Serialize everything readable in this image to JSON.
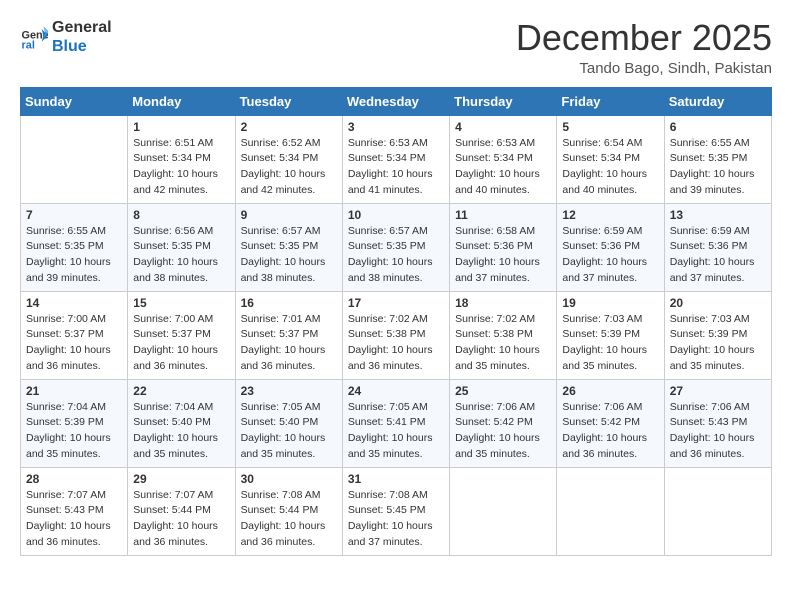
{
  "logo": {
    "line1": "General",
    "line2": "Blue"
  },
  "header": {
    "month": "December 2025",
    "location": "Tando Bago, Sindh, Pakistan"
  },
  "days_of_week": [
    "Sunday",
    "Monday",
    "Tuesday",
    "Wednesday",
    "Thursday",
    "Friday",
    "Saturday"
  ],
  "weeks": [
    [
      {
        "day": "",
        "sunrise": "",
        "sunset": "",
        "daylight": ""
      },
      {
        "day": "1",
        "sunrise": "6:51 AM",
        "sunset": "5:34 PM",
        "daylight": "10 hours and 42 minutes."
      },
      {
        "day": "2",
        "sunrise": "6:52 AM",
        "sunset": "5:34 PM",
        "daylight": "10 hours and 42 minutes."
      },
      {
        "day": "3",
        "sunrise": "6:53 AM",
        "sunset": "5:34 PM",
        "daylight": "10 hours and 41 minutes."
      },
      {
        "day": "4",
        "sunrise": "6:53 AM",
        "sunset": "5:34 PM",
        "daylight": "10 hours and 40 minutes."
      },
      {
        "day": "5",
        "sunrise": "6:54 AM",
        "sunset": "5:34 PM",
        "daylight": "10 hours and 40 minutes."
      },
      {
        "day": "6",
        "sunrise": "6:55 AM",
        "sunset": "5:35 PM",
        "daylight": "10 hours and 39 minutes."
      }
    ],
    [
      {
        "day": "7",
        "sunrise": "6:55 AM",
        "sunset": "5:35 PM",
        "daylight": "10 hours and 39 minutes."
      },
      {
        "day": "8",
        "sunrise": "6:56 AM",
        "sunset": "5:35 PM",
        "daylight": "10 hours and 38 minutes."
      },
      {
        "day": "9",
        "sunrise": "6:57 AM",
        "sunset": "5:35 PM",
        "daylight": "10 hours and 38 minutes."
      },
      {
        "day": "10",
        "sunrise": "6:57 AM",
        "sunset": "5:35 PM",
        "daylight": "10 hours and 38 minutes."
      },
      {
        "day": "11",
        "sunrise": "6:58 AM",
        "sunset": "5:36 PM",
        "daylight": "10 hours and 37 minutes."
      },
      {
        "day": "12",
        "sunrise": "6:59 AM",
        "sunset": "5:36 PM",
        "daylight": "10 hours and 37 minutes."
      },
      {
        "day": "13",
        "sunrise": "6:59 AM",
        "sunset": "5:36 PM",
        "daylight": "10 hours and 37 minutes."
      }
    ],
    [
      {
        "day": "14",
        "sunrise": "7:00 AM",
        "sunset": "5:37 PM",
        "daylight": "10 hours and 36 minutes."
      },
      {
        "day": "15",
        "sunrise": "7:00 AM",
        "sunset": "5:37 PM",
        "daylight": "10 hours and 36 minutes."
      },
      {
        "day": "16",
        "sunrise": "7:01 AM",
        "sunset": "5:37 PM",
        "daylight": "10 hours and 36 minutes."
      },
      {
        "day": "17",
        "sunrise": "7:02 AM",
        "sunset": "5:38 PM",
        "daylight": "10 hours and 36 minutes."
      },
      {
        "day": "18",
        "sunrise": "7:02 AM",
        "sunset": "5:38 PM",
        "daylight": "10 hours and 35 minutes."
      },
      {
        "day": "19",
        "sunrise": "7:03 AM",
        "sunset": "5:39 PM",
        "daylight": "10 hours and 35 minutes."
      },
      {
        "day": "20",
        "sunrise": "7:03 AM",
        "sunset": "5:39 PM",
        "daylight": "10 hours and 35 minutes."
      }
    ],
    [
      {
        "day": "21",
        "sunrise": "7:04 AM",
        "sunset": "5:39 PM",
        "daylight": "10 hours and 35 minutes."
      },
      {
        "day": "22",
        "sunrise": "7:04 AM",
        "sunset": "5:40 PM",
        "daylight": "10 hours and 35 minutes."
      },
      {
        "day": "23",
        "sunrise": "7:05 AM",
        "sunset": "5:40 PM",
        "daylight": "10 hours and 35 minutes."
      },
      {
        "day": "24",
        "sunrise": "7:05 AM",
        "sunset": "5:41 PM",
        "daylight": "10 hours and 35 minutes."
      },
      {
        "day": "25",
        "sunrise": "7:06 AM",
        "sunset": "5:42 PM",
        "daylight": "10 hours and 35 minutes."
      },
      {
        "day": "26",
        "sunrise": "7:06 AM",
        "sunset": "5:42 PM",
        "daylight": "10 hours and 36 minutes."
      },
      {
        "day": "27",
        "sunrise": "7:06 AM",
        "sunset": "5:43 PM",
        "daylight": "10 hours and 36 minutes."
      }
    ],
    [
      {
        "day": "28",
        "sunrise": "7:07 AM",
        "sunset": "5:43 PM",
        "daylight": "10 hours and 36 minutes."
      },
      {
        "day": "29",
        "sunrise": "7:07 AM",
        "sunset": "5:44 PM",
        "daylight": "10 hours and 36 minutes."
      },
      {
        "day": "30",
        "sunrise": "7:08 AM",
        "sunset": "5:44 PM",
        "daylight": "10 hours and 36 minutes."
      },
      {
        "day": "31",
        "sunrise": "7:08 AM",
        "sunset": "5:45 PM",
        "daylight": "10 hours and 37 minutes."
      },
      {
        "day": "",
        "sunrise": "",
        "sunset": "",
        "daylight": ""
      },
      {
        "day": "",
        "sunrise": "",
        "sunset": "",
        "daylight": ""
      },
      {
        "day": "",
        "sunrise": "",
        "sunset": "",
        "daylight": ""
      }
    ]
  ]
}
